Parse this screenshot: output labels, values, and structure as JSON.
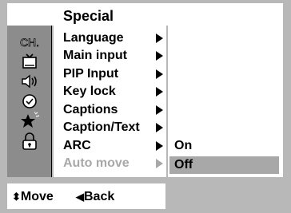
{
  "header": {
    "title": "Special"
  },
  "icons": [
    {
      "name": "channel-icon",
      "label": "CH."
    },
    {
      "name": "tv-icon"
    },
    {
      "name": "speaker-icon"
    },
    {
      "name": "clock-icon"
    },
    {
      "name": "star-icon"
    },
    {
      "name": "lock-icon"
    }
  ],
  "menu": {
    "items": [
      {
        "label": "Language",
        "enabled": true
      },
      {
        "label": "Main input",
        "enabled": true
      },
      {
        "label": "PIP Input",
        "enabled": true
      },
      {
        "label": "Key lock",
        "enabled": true
      },
      {
        "label": "Captions",
        "enabled": true
      },
      {
        "label": "Caption/Text",
        "enabled": true
      },
      {
        "label": "ARC",
        "enabled": true
      },
      {
        "label": "Auto move",
        "enabled": false
      }
    ]
  },
  "submenu": {
    "options": [
      {
        "label": "On",
        "selected": false
      },
      {
        "label": "Off",
        "selected": true
      }
    ]
  },
  "footer": {
    "move_glyph": "⬍",
    "move_label": "Move",
    "back_glyph": "◀",
    "back_label": "Back"
  }
}
